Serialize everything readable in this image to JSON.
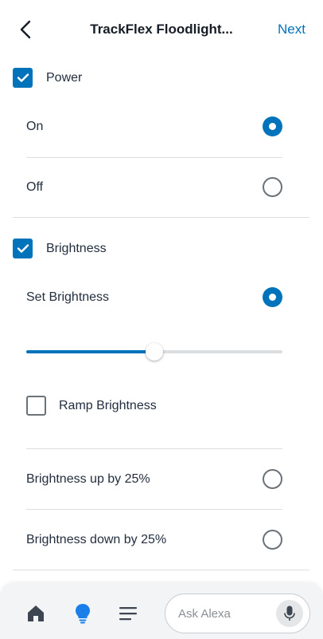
{
  "header": {
    "back_icon": "chevron-left-icon",
    "title": "TrackFlex Floodlight...",
    "next_label": "Next"
  },
  "power": {
    "label": "Power",
    "checked": true,
    "options": [
      {
        "label": "On",
        "selected": true
      },
      {
        "label": "Off",
        "selected": false
      }
    ]
  },
  "brightness": {
    "label": "Brightness",
    "checked": true,
    "set_label": "Set Brightness",
    "set_selected": true,
    "slider_value_fraction": 0.5,
    "ramp_label": "Ramp Brightness",
    "ramp_checked": false,
    "options": [
      {
        "label": "Brightness up by 25%",
        "selected": false
      },
      {
        "label": "Brightness down by 25%",
        "selected": false
      }
    ]
  },
  "bottom_nav": {
    "items": [
      "home-icon",
      "devices-bulb-icon",
      "menu-icon"
    ],
    "ask_placeholder": "Ask Alexa",
    "mic_icon": "mic-icon"
  },
  "colors": {
    "accent": "#0073bb",
    "active_bulb": "#1a7fe8",
    "divider": "#dcdfe2"
  }
}
